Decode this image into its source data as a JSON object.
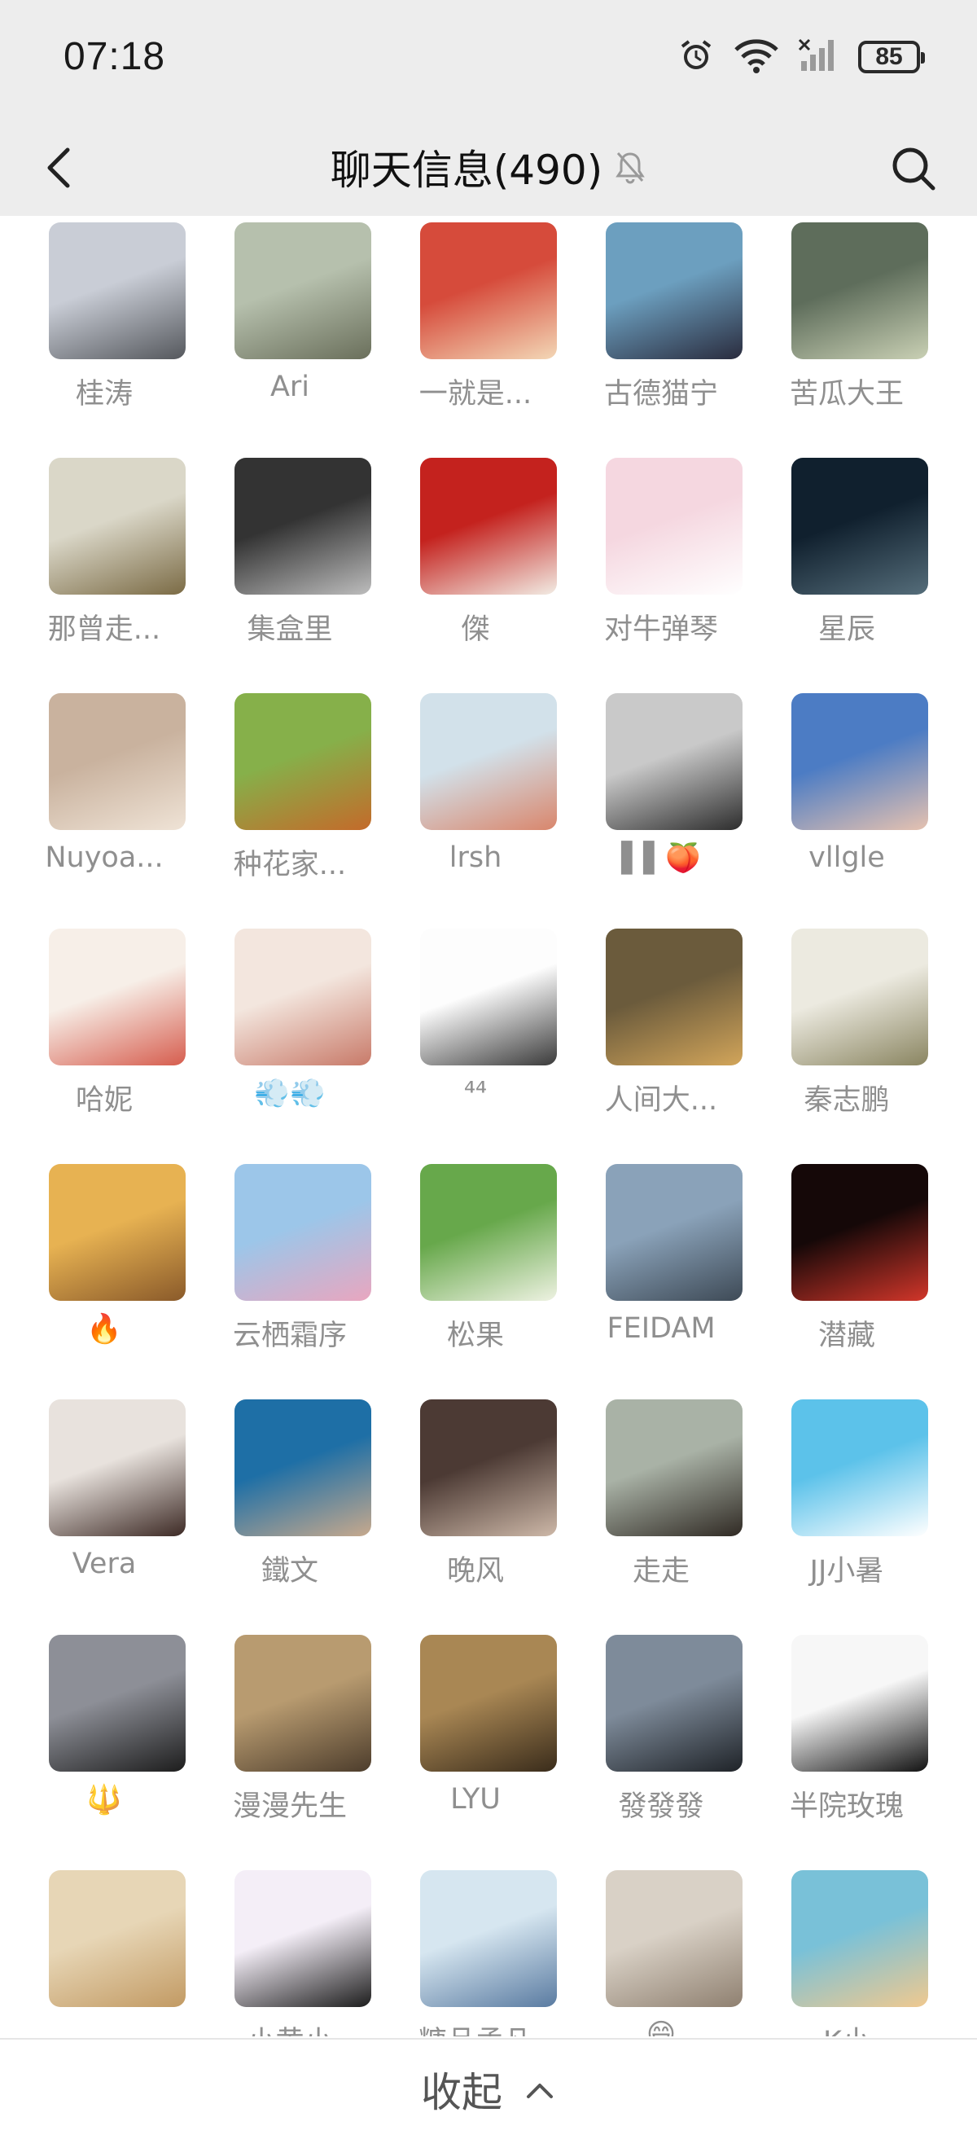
{
  "status_bar": {
    "time": "07:18",
    "battery": "85",
    "icons": [
      "alarm-icon",
      "wifi-icon",
      "signal-icon",
      "battery-icon"
    ]
  },
  "header": {
    "title": "聊天信息(490)",
    "icons": [
      "back-icon",
      "mute-bell-icon",
      "search-icon"
    ]
  },
  "members": [
    {
      "name": "桂涛",
      "colors": [
        "#c9cdd6",
        "#55585d"
      ]
    },
    {
      "name": "Ari",
      "colors": [
        "#b6c0ad",
        "#6a6f5b"
      ]
    },
    {
      "name": "一就是...",
      "colors": [
        "#d64b3b",
        "#f3d7b6"
      ]
    },
    {
      "name": "古德猫宁",
      "colors": [
        "#6c9fbf",
        "#2a2c3e"
      ]
    },
    {
      "name": "苦瓜大王",
      "colors": [
        "#5e6d5b",
        "#c9d0b4"
      ]
    },
    {
      "name": "那曾走...",
      "colors": [
        "#dad7c8",
        "#7b6b45"
      ]
    },
    {
      "name": "集盒里",
      "colors": [
        "#333333",
        "#bdbdbd"
      ]
    },
    {
      "name": "傑",
      "colors": [
        "#c4221e",
        "#f2ece4"
      ]
    },
    {
      "name": "对牛弹琴",
      "colors": [
        "#f5d7e0",
        "#ffffff"
      ]
    },
    {
      "name": "星辰",
      "colors": [
        "#10202e",
        "#556d7a"
      ]
    },
    {
      "name": "Nuyoa...",
      "colors": [
        "#c9b29e",
        "#efe3d6"
      ]
    },
    {
      "name": "种花家...",
      "colors": [
        "#86b04a",
        "#c46a2a"
      ]
    },
    {
      "name": "lrsh",
      "colors": [
        "#d2e1ea",
        "#d9866c"
      ]
    },
    {
      "name": "▌▌🍑",
      "colors": [
        "#c9c9c9",
        "#2d2d2d"
      ]
    },
    {
      "name": "vllgle",
      "colors": [
        "#4c7cc4",
        "#e6c2b0"
      ]
    },
    {
      "name": "哈妮",
      "colors": [
        "#f7efe8",
        "#d65d4e"
      ]
    },
    {
      "name": "💨💨",
      "colors": [
        "#f3e6de",
        "#c87a69"
      ]
    },
    {
      "name": "⁴⁴",
      "colors": [
        "#fdfdfd",
        "#3a3a3a"
      ]
    },
    {
      "name": "人间大...",
      "colors": [
        "#6b5b3c",
        "#d2a55a"
      ]
    },
    {
      "name": "秦志鹏",
      "colors": [
        "#eceae0",
        "#8a8561"
      ]
    },
    {
      "name": "🔥",
      "colors": [
        "#e7b252",
        "#8a5a2a"
      ]
    },
    {
      "name": "云栖霜序",
      "colors": [
        "#9cc6e9",
        "#e9a6bf"
      ]
    },
    {
      "name": "松果",
      "colors": [
        "#67a84b",
        "#eef2e2"
      ]
    },
    {
      "name": "FEIDAM",
      "colors": [
        "#8aa2b9",
        "#3e4a56"
      ]
    },
    {
      "name": "潜藏",
      "colors": [
        "#150808",
        "#d2362a"
      ]
    },
    {
      "name": "Vera",
      "colors": [
        "#e8e2dd",
        "#3d2a25"
      ]
    },
    {
      "name": "鐵文",
      "colors": [
        "#1e6fa6",
        "#c7a98d"
      ]
    },
    {
      "name": "晚风",
      "colors": [
        "#4c3a34",
        "#cdb8a8"
      ]
    },
    {
      "name": "走走",
      "colors": [
        "#a9b2a6",
        "#302a24"
      ]
    },
    {
      "name": "JJ小暑",
      "colors": [
        "#5cc2ea",
        "#ffffff"
      ]
    },
    {
      "name": "🔱",
      "colors": [
        "#8d8f97",
        "#1d1d1d"
      ]
    },
    {
      "name": "漫漫先生",
      "colors": [
        "#b89b70",
        "#4d3d2c"
      ]
    },
    {
      "name": "LYU",
      "colors": [
        "#a98754",
        "#3a2c1b"
      ]
    },
    {
      "name": "發發發",
      "colors": [
        "#7e8b9a",
        "#1f2328"
      ]
    },
    {
      "name": "半院玫瑰",
      "colors": [
        "#f7f7f7",
        "#121212"
      ]
    },
    {
      "name": "",
      "colors": [
        "#e7d6b6",
        "#c29a63"
      ]
    },
    {
      "name": "小黄小",
      "colors": [
        "#f4eef7",
        "#1d1d1d"
      ]
    },
    {
      "name": "糖品孟凡",
      "colors": [
        "#d6e6f0",
        "#5a7ba1"
      ]
    },
    {
      "name": "😄",
      "colors": [
        "#d9d1c6",
        "#8f8070"
      ]
    },
    {
      "name": "K小",
      "colors": [
        "#79c1d8",
        "#f0c98f"
      ]
    }
  ],
  "footer": {
    "collapse_label": "收起",
    "icon": "chevron-up-icon"
  }
}
